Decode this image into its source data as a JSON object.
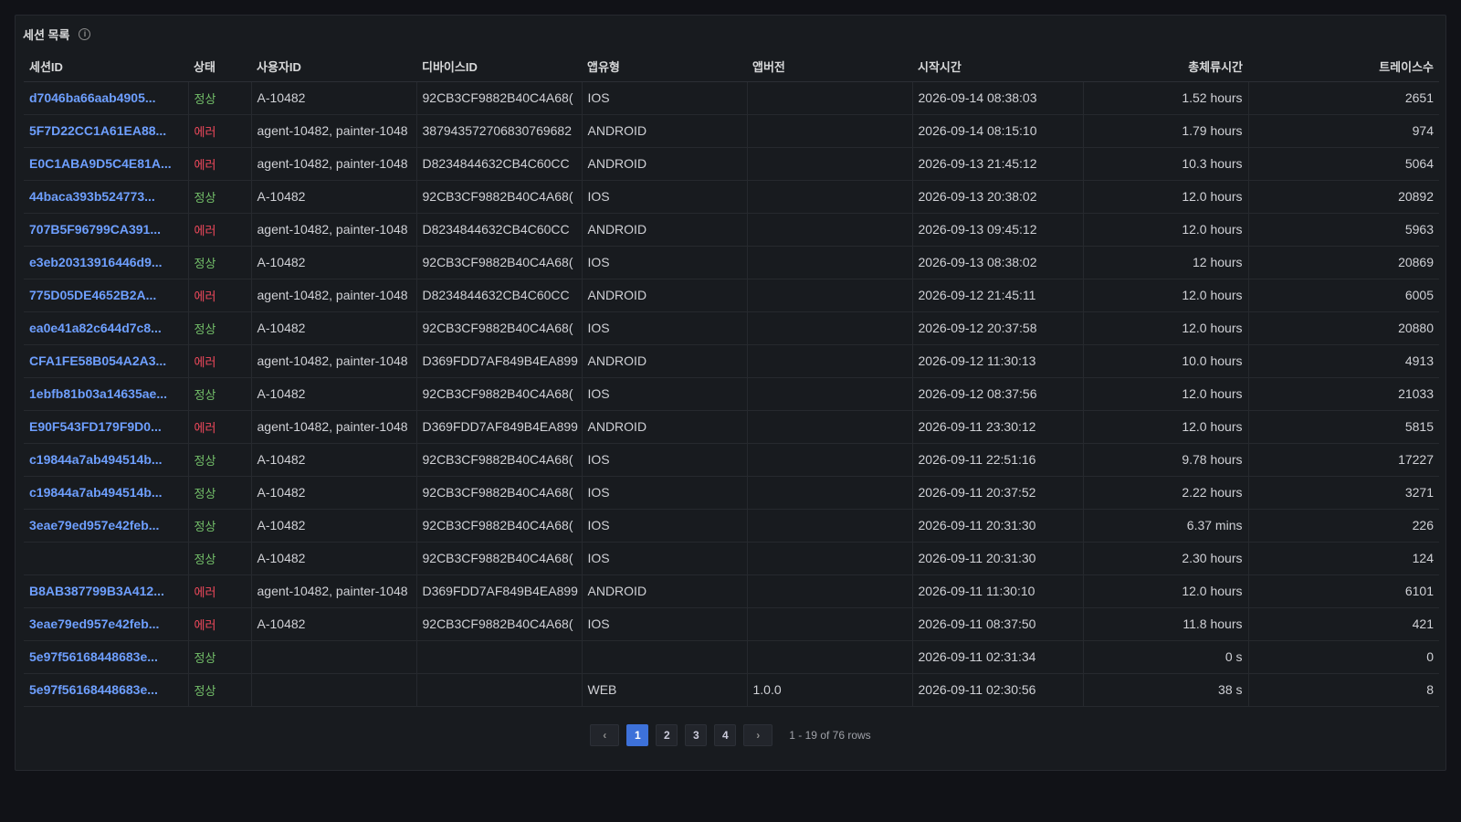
{
  "panel": {
    "title": "세션 목록",
    "info_icon": "info-icon"
  },
  "table": {
    "columns": [
      "세션ID",
      "상태",
      "사용자ID",
      "디바이스ID",
      "앱유형",
      "앱버전",
      "시작시간",
      "총체류시간",
      "트레이스수"
    ],
    "rows": [
      [
        "d7046ba66aab4905...",
        "정상",
        "A-10482",
        "92CB3CF9882B40C4A68(",
        "IOS",
        "",
        "2026-09-14 08:38:03",
        "1.52 hours",
        "2651"
      ],
      [
        "5F7D22CC1A61EA88...",
        "에러",
        "agent-10482, painter-1048",
        "387943572706830769682",
        "ANDROID",
        "",
        "2026-09-14 08:15:10",
        "1.79 hours",
        "974"
      ],
      [
        "E0C1ABA9D5C4E81A...",
        "에러",
        "agent-10482, painter-1048",
        "D8234844632CB4C60CC",
        "ANDROID",
        "",
        "2026-09-13 21:45:12",
        "10.3 hours",
        "5064"
      ],
      [
        "44baca393b524773...",
        "정상",
        "A-10482",
        "92CB3CF9882B40C4A68(",
        "IOS",
        "",
        "2026-09-13 20:38:02",
        "12.0 hours",
        "20892"
      ],
      [
        "707B5F96799CA391...",
        "에러",
        "agent-10482, painter-1048",
        "D8234844632CB4C60CC",
        "ANDROID",
        "",
        "2026-09-13 09:45:12",
        "12.0 hours",
        "5963"
      ],
      [
        "e3eb20313916446d9...",
        "정상",
        "A-10482",
        "92CB3CF9882B40C4A68(",
        "IOS",
        "",
        "2026-09-13 08:38:02",
        "12 hours",
        "20869"
      ],
      [
        "775D05DE4652B2A...",
        "에러",
        "agent-10482, painter-1048",
        "D8234844632CB4C60CC",
        "ANDROID",
        "",
        "2026-09-12 21:45:11",
        "12.0 hours",
        "6005"
      ],
      [
        "ea0e41a82c644d7c8...",
        "정상",
        "A-10482",
        "92CB3CF9882B40C4A68(",
        "IOS",
        "",
        "2026-09-12 20:37:58",
        "12.0 hours",
        "20880"
      ],
      [
        "CFA1FE58B054A2A3...",
        "에러",
        "agent-10482, painter-1048",
        "D369FDD7AF849B4EA899",
        "ANDROID",
        "",
        "2026-09-12 11:30:13",
        "10.0 hours",
        "4913"
      ],
      [
        "1ebfb81b03a14635ae...",
        "정상",
        "A-10482",
        "92CB3CF9882B40C4A68(",
        "IOS",
        "",
        "2026-09-12 08:37:56",
        "12.0 hours",
        "21033"
      ],
      [
        "E90F543FD179F9D0...",
        "에러",
        "agent-10482, painter-1048",
        "D369FDD7AF849B4EA899",
        "ANDROID",
        "",
        "2026-09-11 23:30:12",
        "12.0 hours",
        "5815"
      ],
      [
        "c19844a7ab494514b...",
        "정상",
        "A-10482",
        "92CB3CF9882B40C4A68(",
        "IOS",
        "",
        "2026-09-11 22:51:16",
        "9.78 hours",
        "17227"
      ],
      [
        "c19844a7ab494514b...",
        "정상",
        "A-10482",
        "92CB3CF9882B40C4A68(",
        "IOS",
        "",
        "2026-09-11 20:37:52",
        "2.22 hours",
        "3271"
      ],
      [
        "3eae79ed957e42feb...",
        "정상",
        "A-10482",
        "92CB3CF9882B40C4A68(",
        "IOS",
        "",
        "2026-09-11 20:31:30",
        "6.37 mins",
        "226"
      ],
      [
        "",
        "정상",
        "A-10482",
        "92CB3CF9882B40C4A68(",
        "IOS",
        "",
        "2026-09-11 20:31:30",
        "2.30 hours",
        "124"
      ],
      [
        "B8AB387799B3A412...",
        "에러",
        "agent-10482, painter-1048",
        "D369FDD7AF849B4EA899",
        "ANDROID",
        "",
        "2026-09-11 11:30:10",
        "12.0 hours",
        "6101"
      ],
      [
        "3eae79ed957e42feb...",
        "에러",
        "A-10482",
        "92CB3CF9882B40C4A68(",
        "IOS",
        "",
        "2026-09-11 08:37:50",
        "11.8 hours",
        "421"
      ],
      [
        "5e97f56168448683e...",
        "정상",
        "",
        "",
        "",
        "",
        "2026-09-11 02:31:34",
        "0 s",
        "0"
      ],
      [
        "5e97f56168448683e...",
        "정상",
        "",
        "",
        "WEB",
        "1.0.0",
        "2026-09-11 02:30:56",
        "38 s",
        "8"
      ]
    ]
  },
  "pagination": {
    "prev_icon": "chevron-left-icon",
    "next_icon": "chevron-right-icon",
    "prev_glyph": "‹",
    "next_glyph": "›",
    "pages": [
      "1",
      "2",
      "3",
      "4"
    ],
    "current_page": "1",
    "summary": "1 - 19 of 76 rows"
  },
  "colors": {
    "session_link": "#6e9fff",
    "status_ok": "#73bf69",
    "status_error": "#f2495c",
    "active_page": "#3d71d9"
  }
}
